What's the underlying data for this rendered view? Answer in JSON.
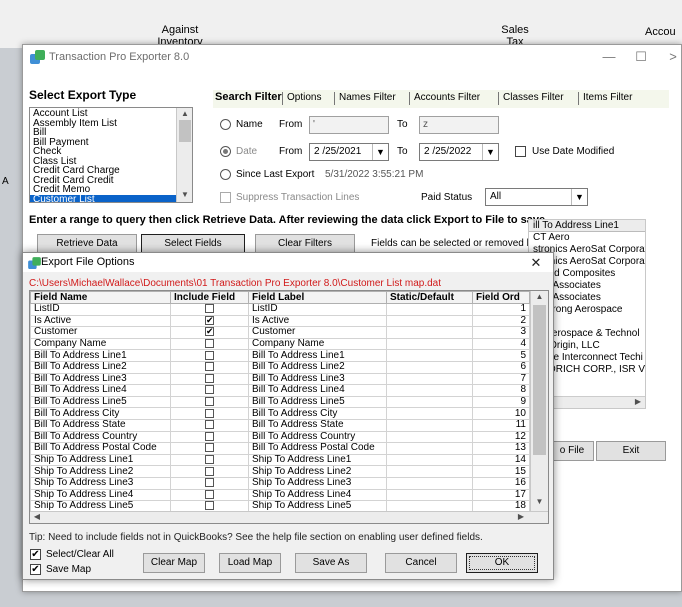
{
  "background": {
    "col_against": "Against\nInventory",
    "col_against_1": "Against",
    "col_against_2": "Inventory",
    "col_sales_1": "Sales",
    "col_sales_2": "Tax",
    "col_acct": "Accou",
    "left_letter": "A"
  },
  "main_window": {
    "title": "Transaction Pro Exporter 8.0",
    "minimize": "—",
    "maximize": "☐",
    "close": ">",
    "select_export_type_label": "Select Export Type",
    "export_types": [
      "Account List",
      "Assembly Item List",
      "Bill",
      "Bill Payment",
      "Check",
      "Class List",
      "Credit Card Charge",
      "Credit Card Credit",
      "Credit Memo",
      "Customer List"
    ],
    "selected_export_type": "Customer List",
    "tabs": [
      "Search Filter",
      "Options",
      "Names Filter",
      "Accounts Filter",
      "Classes Filter",
      "Items Filter"
    ],
    "search_filter": {
      "name_label": "Name",
      "from_label": "From",
      "name_from_value": "'",
      "to_label": "To",
      "name_to_value": "z",
      "date_label": "Date",
      "date_from": "2 /25/2021",
      "date_to": "2 /25/2022",
      "use_date_modified": "Use Date Modified",
      "since_last_export": "Since Last Export",
      "last_export_time": "5/31/2022 3:55:21 PM",
      "suppress_lines": "Suppress Transaction Lines",
      "paid_status_label": "Paid Status",
      "paid_status_value": "All"
    },
    "instruction": "Enter a range to query then click Retrieve Data. After reviewing the data click Export to File to save.",
    "buttons": {
      "retrieve_data": "Retrieve Data",
      "select_fields": "Select Fields",
      "clear_filters": "Clear Filters",
      "export_to_file": "o File",
      "exit": "Exit"
    },
    "fields_hint": "Fields can be selected or removed by clicking Select Fields.",
    "results_header": "ill To Address Line1",
    "results": [
      "CT Aero",
      "stronics AeroSat Corporat",
      "stronics AeroSat Corporat",
      "pplied Composites",
      "rete Associates",
      "rete Associates",
      "rmstrong Aerospace",
      "",
      "all Aerospace & Technol",
      "lue Origin, LLC",
      "arlisle Interconnect Techi",
      "OODRICH CORP., ISR V"
    ]
  },
  "dialog": {
    "title": "Export File Options",
    "close": "✕",
    "map_path": "C:\\Users\\MichaelWallace\\Documents\\01 Transaction Pro Exporter 8.0\\Customer List map.dat",
    "columns": [
      "Field Name",
      "Include Field",
      "Field Label",
      "Static/Default",
      "Field Ord"
    ],
    "rows": [
      {
        "name": "ListID",
        "include": "",
        "label": "ListID",
        "order": "1"
      },
      {
        "name": "Is Active",
        "include": "✔",
        "label": "Is Active",
        "order": "2"
      },
      {
        "name": "Customer",
        "include": "✔",
        "label": "Customer",
        "order": "3"
      },
      {
        "name": "Company Name",
        "include": "",
        "label": "Company Name",
        "order": "4"
      },
      {
        "name": "Bill To Address Line1",
        "include": "",
        "label": "Bill To Address Line1",
        "order": "5"
      },
      {
        "name": "Bill To Address Line2",
        "include": "",
        "label": "Bill To Address Line2",
        "order": "6"
      },
      {
        "name": "Bill To Address Line3",
        "include": "",
        "label": "Bill To Address Line3",
        "order": "7"
      },
      {
        "name": "Bill To Address Line4",
        "include": "",
        "label": "Bill To Address Line4",
        "order": "8"
      },
      {
        "name": "Bill To Address Line5",
        "include": "",
        "label": "Bill To Address Line5",
        "order": "9"
      },
      {
        "name": "Bill To Address City",
        "include": "",
        "label": "Bill To Address City",
        "order": "10"
      },
      {
        "name": "Bill To Address State",
        "include": "",
        "label": "Bill To Address State",
        "order": "11"
      },
      {
        "name": "Bill To Address Country",
        "include": "",
        "label": "Bill To Address Country",
        "order": "12"
      },
      {
        "name": "Bill To Address Postal Code",
        "include": "",
        "label": "Bill To Address Postal Code",
        "order": "13"
      },
      {
        "name": "Ship To Address Line1",
        "include": "",
        "label": "Ship To Address Line1",
        "order": "14"
      },
      {
        "name": "Ship To Address Line2",
        "include": "",
        "label": "Ship To Address Line2",
        "order": "15"
      },
      {
        "name": "Ship To Address Line3",
        "include": "",
        "label": "Ship To Address Line3",
        "order": "16"
      },
      {
        "name": "Ship To Address Line4",
        "include": "",
        "label": "Ship To Address Line4",
        "order": "17"
      },
      {
        "name": "Ship To Address Line5",
        "include": "",
        "label": "Ship To Address Line5",
        "order": "18"
      }
    ],
    "tip": "Tip: Need to include fields not in QuickBooks? See the help file section on enabling user defined fields.",
    "select_clear_all": "Select/Clear All",
    "save_map": "Save Map",
    "check_mark": "✔",
    "buttons": {
      "clear_map": "Clear Map",
      "load_map": "Load Map",
      "save_as": "Save As",
      "cancel": "Cancel",
      "ok": "OK"
    }
  },
  "colors": {
    "selection": "#0a63c9",
    "path_text": "#d11a1a",
    "tab_strip": "#f4f7ec"
  }
}
